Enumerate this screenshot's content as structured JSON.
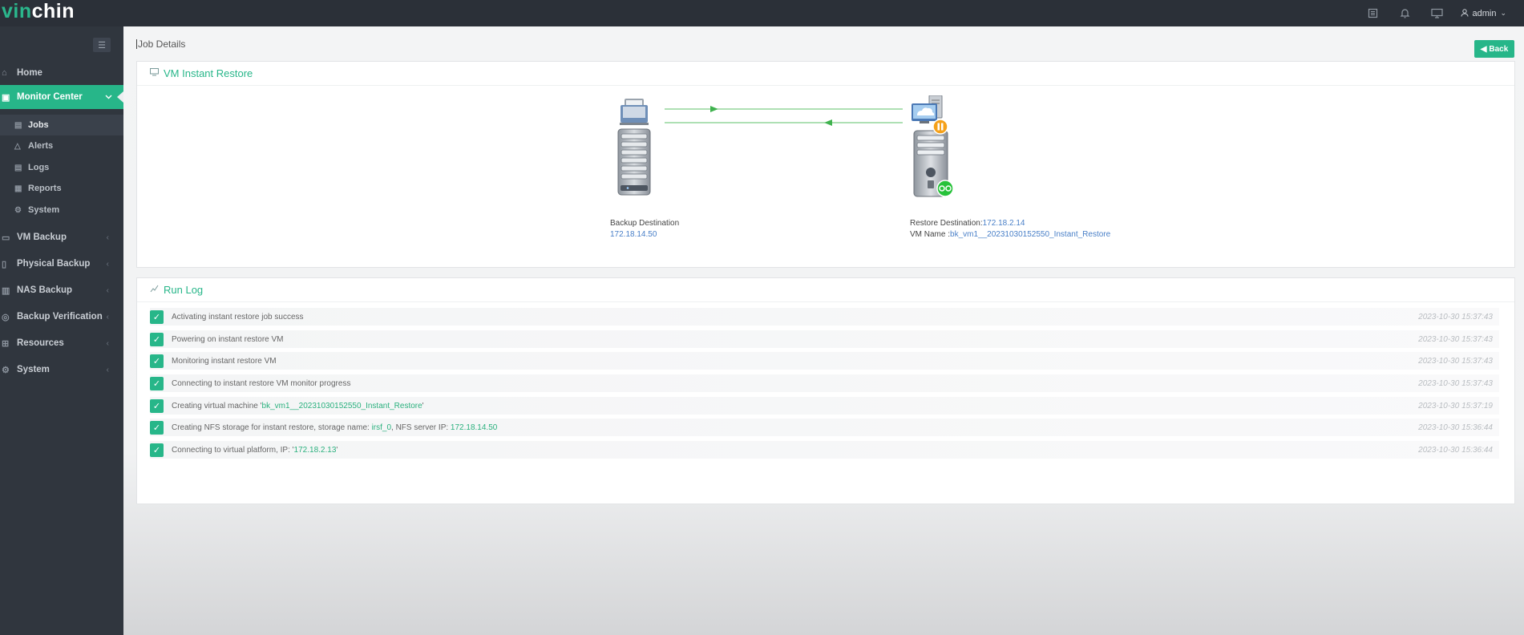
{
  "app": {
    "logo_part1": "vin",
    "logo_part2": "chin",
    "user": "admin"
  },
  "icons": {
    "task_list": "clipboard-icon",
    "notifications": "bell-icon",
    "monitor": "desktop-icon",
    "user": "user-icon",
    "chevron": "chevron-down-icon"
  },
  "sidebar": {
    "items": [
      {
        "label": "Home",
        "icon": "home-icon"
      },
      {
        "label": "Monitor Center",
        "icon": "monitor-icon"
      },
      {
        "label": "VM Backup",
        "icon": "vm-icon"
      },
      {
        "label": "Physical Backup",
        "icon": "server-icon"
      },
      {
        "label": "NAS Backup",
        "icon": "nas-icon"
      },
      {
        "label": "Backup Verification",
        "icon": "verify-icon"
      },
      {
        "label": "Resources",
        "icon": "grid-icon"
      },
      {
        "label": "System",
        "icon": "gear-icon"
      }
    ],
    "sub_items": [
      {
        "label": "Jobs",
        "icon": "list-icon"
      },
      {
        "label": "Alerts",
        "icon": "bell-icon"
      },
      {
        "label": "Logs",
        "icon": "document-icon"
      },
      {
        "label": "Reports",
        "icon": "report-icon"
      },
      {
        "label": "System",
        "icon": "gear-icon"
      }
    ]
  },
  "main": {
    "title": "Job Details",
    "back_label": "Back",
    "restore_panel": {
      "title": "VM Instant Restore",
      "backup_dest_label": "Backup Destination",
      "backup_dest_ip": "172.18.14.50",
      "restore_dest_label": "Restore Destination:",
      "restore_dest_ip": "172.18.2.14",
      "vm_name_label": "VM Name :",
      "vm_name": "bk_vm1__20231030152550_Instant_Restore"
    },
    "run_log": {
      "title": "Run Log",
      "rows": [
        {
          "pre": "Activating instant restore job success",
          "hl": "",
          "post": "",
          "hl2": "",
          "post2": "",
          "time": "2023-10-30 15:37:43"
        },
        {
          "pre": "Powering on instant restore VM",
          "hl": "",
          "post": "",
          "hl2": "",
          "post2": "",
          "time": "2023-10-30 15:37:43"
        },
        {
          "pre": "Monitoring instant restore VM",
          "hl": "",
          "post": "",
          "hl2": "",
          "post2": "",
          "time": "2023-10-30 15:37:43"
        },
        {
          "pre": "Connecting to instant restore VM monitor progress",
          "hl": "",
          "post": "",
          "hl2": "",
          "post2": "",
          "time": "2023-10-30 15:37:43"
        },
        {
          "pre": "Creating virtual machine '",
          "hl": "bk_vm1__20231030152550_Instant_Restore",
          "post": "'",
          "hl2": "",
          "post2": "",
          "time": "2023-10-30 15:37:19"
        },
        {
          "pre": "Creating NFS storage for instant restore, storage name: ",
          "hl": "irsf_0",
          "post": ", NFS server IP: ",
          "hl2": "172.18.14.50",
          "post2": "",
          "time": "2023-10-30 15:36:44"
        },
        {
          "pre": "Connecting to virtual platform, IP: '",
          "hl": "172.18.2.13",
          "post": "'",
          "hl2": "",
          "post2": "",
          "time": "2023-10-30 15:36:44"
        }
      ]
    }
  }
}
